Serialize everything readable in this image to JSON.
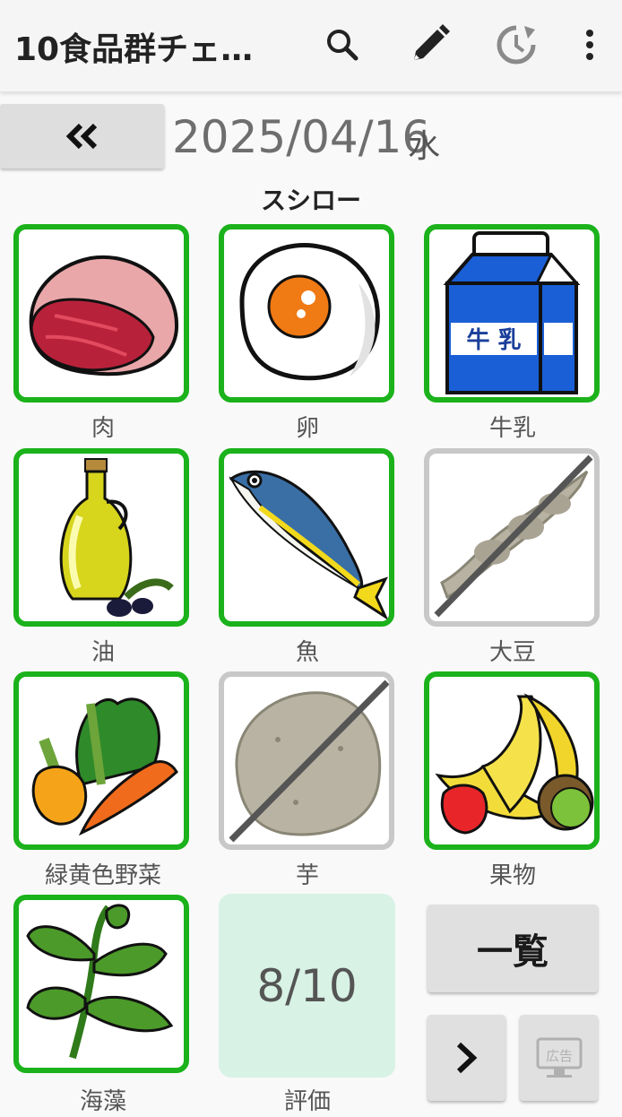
{
  "app_bar": {
    "title": "10食品群チェ…",
    "actions": [
      "search-icon",
      "edit-pencil-icon",
      "history-icon",
      "more-vert-icon"
    ]
  },
  "date_nav": {
    "prev_icon": "double-chevron-left-icon",
    "date": "2025/04/16",
    "weekday": "水"
  },
  "place": "スシロー",
  "food_groups": [
    {
      "label": "肉",
      "checked": true,
      "icon": "meat-icon"
    },
    {
      "label": "卵",
      "checked": true,
      "icon": "egg-icon"
    },
    {
      "label": "牛乳",
      "checked": true,
      "icon": "milk-carton-icon",
      "carton_text": "牛 乳"
    },
    {
      "label": "油",
      "checked": true,
      "icon": "oil-bottle-icon"
    },
    {
      "label": "魚",
      "checked": true,
      "icon": "fish-icon"
    },
    {
      "label": "大豆",
      "checked": false,
      "icon": "soybean-icon"
    },
    {
      "label": "緑黄色野菜",
      "checked": true,
      "icon": "vegetables-icon"
    },
    {
      "label": "芋",
      "checked": false,
      "icon": "potato-icon"
    },
    {
      "label": "果物",
      "checked": true,
      "icon": "fruit-icon"
    },
    {
      "label": "海藻",
      "checked": true,
      "icon": "seaweed-icon"
    }
  ],
  "score": {
    "value": "8/10",
    "label": "評価"
  },
  "buttons": {
    "list_label": "一覧",
    "next_icon": "chevron-right-icon",
    "ad_label": "広告"
  },
  "colors": {
    "checked_border": "#1bb21b",
    "unchecked_border": "#c8c8c8",
    "score_bg": "#d8f2e6"
  }
}
